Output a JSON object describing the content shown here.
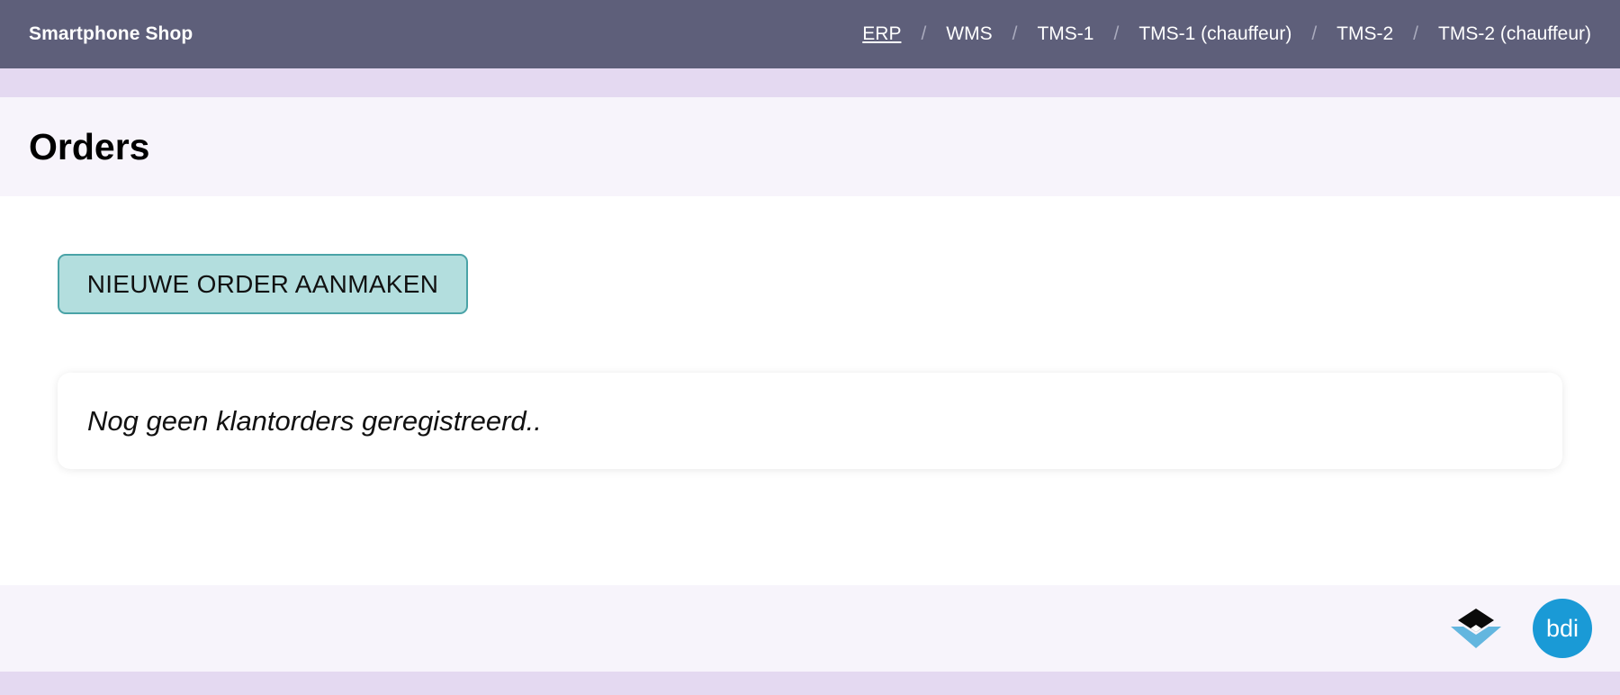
{
  "header": {
    "brand": "Smartphone Shop",
    "nav": [
      {
        "label": "ERP",
        "active": true
      },
      {
        "label": "WMS"
      },
      {
        "label": "TMS-1"
      },
      {
        "label": "TMS-1 (chauffeur)"
      },
      {
        "label": "TMS-2"
      },
      {
        "label": "TMS-2 (chauffeur)"
      }
    ],
    "separator": "/"
  },
  "page": {
    "title": "Orders"
  },
  "main": {
    "new_order_button": "NIEUWE ORDER AANMAKEN",
    "empty_message": "Nog geen klantorders geregistreerd.."
  },
  "footer": {
    "logos": [
      "layers-logo-icon",
      "bdi-logo-icon"
    ],
    "bdi_logo_text": "bdi"
  },
  "colors": {
    "header_bg": "#5e5f7a",
    "band_bg": "#e4d9f1",
    "title_bg": "#f7f4fb",
    "button_bg": "#b3dede",
    "button_border": "#4aa3a7",
    "bdi_blue": "#1a9ad6"
  }
}
